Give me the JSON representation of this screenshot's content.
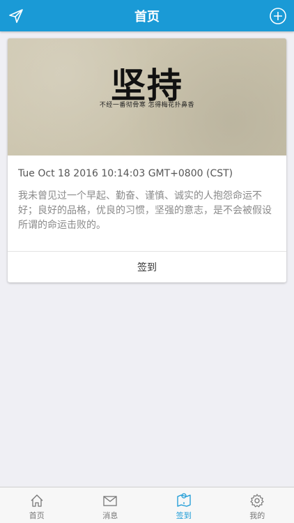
{
  "header": {
    "title": "首页",
    "left_icon": "send-icon",
    "right_icon": "add-circle-icon"
  },
  "card": {
    "hero_title": "坚持",
    "hero_subtitle": "不经一番彻骨寒 怎得梅花扑鼻香",
    "date": "Tue Oct 18 2016 10:14:03 GMT+0800 (CST)",
    "text": "我未曾见过一个早起、勤奋、谨慎、诚实的人抱怨命运不好；良好的品格，优良的习惯，坚强的意志，是不会被假设所谓的命运击败的。",
    "action_label": "签到"
  },
  "tabs": [
    {
      "label": "首页",
      "icon": "home-icon",
      "active": false
    },
    {
      "label": "消息",
      "icon": "mail-icon",
      "active": false
    },
    {
      "label": "签到",
      "icon": "map-pin-icon",
      "active": true
    },
    {
      "label": "我的",
      "icon": "gear-icon",
      "active": false
    }
  ],
  "colors": {
    "accent": "#1a9ad6",
    "background": "#efeff4",
    "inactive": "#777777"
  }
}
